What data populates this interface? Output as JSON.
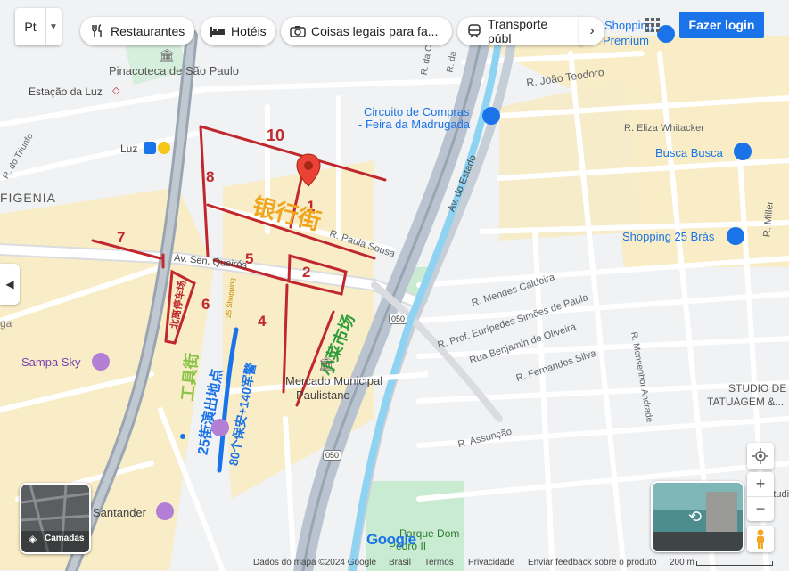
{
  "map": {
    "lang_button": "Pt",
    "categories": [
      "Restaurantes",
      "Hotéis",
      "Coisas legais para fa...",
      "Transporte públ"
    ],
    "login_label": "Fazer login",
    "layers_label": "Camadas",
    "google_logo": "Google",
    "labels": {
      "pinacoteca": "Pinacoteca de São Paulo",
      "estacao_luz": "Estação da Luz",
      "luz": "Luz",
      "circuito_1": "Circuito de Compras",
      "circuito_2": "- Feira da Madrugada",
      "shopping_premium_1": "Shopping",
      "shopping_premium_2": "Premium",
      "joao_teodoro": "R. João Teodoro",
      "eliza_whitacker": "R. Eliza Whitacker",
      "busca_busca": "Busca Busca",
      "shopping_25bras": "Shopping 25 Brás",
      "miller": "R. Miller",
      "ifigenia": "FIGENIA",
      "av_estado": "Av. do Estado",
      "paula_sousa": "R. Paula Sousa",
      "av_senador": "Av. Sen. Queirós",
      "mendes_caldeira": "R. Mendes Caldeira",
      "euripedes": "R. Prof. Eurípedes Simões de Paula",
      "benjamin": "Rua Benjamin de Oliveira",
      "fernandes_silva": "R. Fernandes Silva",
      "monsenhor": "R. Monsenhor Andrade",
      "assuncao": "R. Assunção",
      "mercado_1": "Mercado Municipal",
      "mercado_2": "Paulistano",
      "sampa_sky": "Sampa Sky",
      "santander": "Santander",
      "parque_dom_1": "Parque Dom",
      "parque_dom_2": "Pedro II",
      "studio_1": "STUDIO DE",
      "studio_2": "TATUAGEM &...",
      "shopping_25": "25 Shopping",
      "r_da_c": "R. da C",
      "r_da": "R. da",
      "triunfo": "R. do Triunfo",
      "road_050a": "050",
      "road_050b": "050",
      "studio_e": "Studio E",
      "road_ga": "ga"
    },
    "annotations": {
      "n1": "1",
      "n2": "2",
      "n4": "4",
      "n5": "5",
      "n6": "6",
      "n7": "7",
      "n8": "8",
      "n10": "10",
      "bank_street": "银行街",
      "north_parking": "北离停车场",
      "tools_street": "工具街",
      "market": "小菜市场",
      "venue_1": "25街演出地点",
      "venue_2": "80个保安+140军警"
    },
    "footer": {
      "map_data": "Dados do mapa ©2024 Google",
      "country": "Brasil",
      "terms": "Termos",
      "privacy": "Privacidade",
      "feedback": "Enviar feedback sobre o produto",
      "scale": "200 m"
    },
    "colors": {
      "annotation_red": "#c0282d",
      "river_blue": "#8fd3f2",
      "poi_blue": "#1a73e8",
      "park_green": "#c9ebd1",
      "commerce_yellow": "#f8edc6"
    }
  }
}
